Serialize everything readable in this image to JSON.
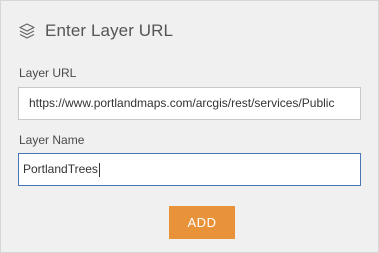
{
  "header": {
    "icon": "layers-icon",
    "title": "Enter Layer URL"
  },
  "form": {
    "url_label": "Layer URL",
    "url_value": "https://www.portlandmaps.com/arcgis/rest/services/Public",
    "name_label": "Layer Name",
    "name_value": "PortlandTrees"
  },
  "actions": {
    "add_label": "ADD"
  },
  "colors": {
    "accent": "#e8923a",
    "focus_border": "#4a76b7",
    "panel_bg": "#f0f0f0"
  }
}
